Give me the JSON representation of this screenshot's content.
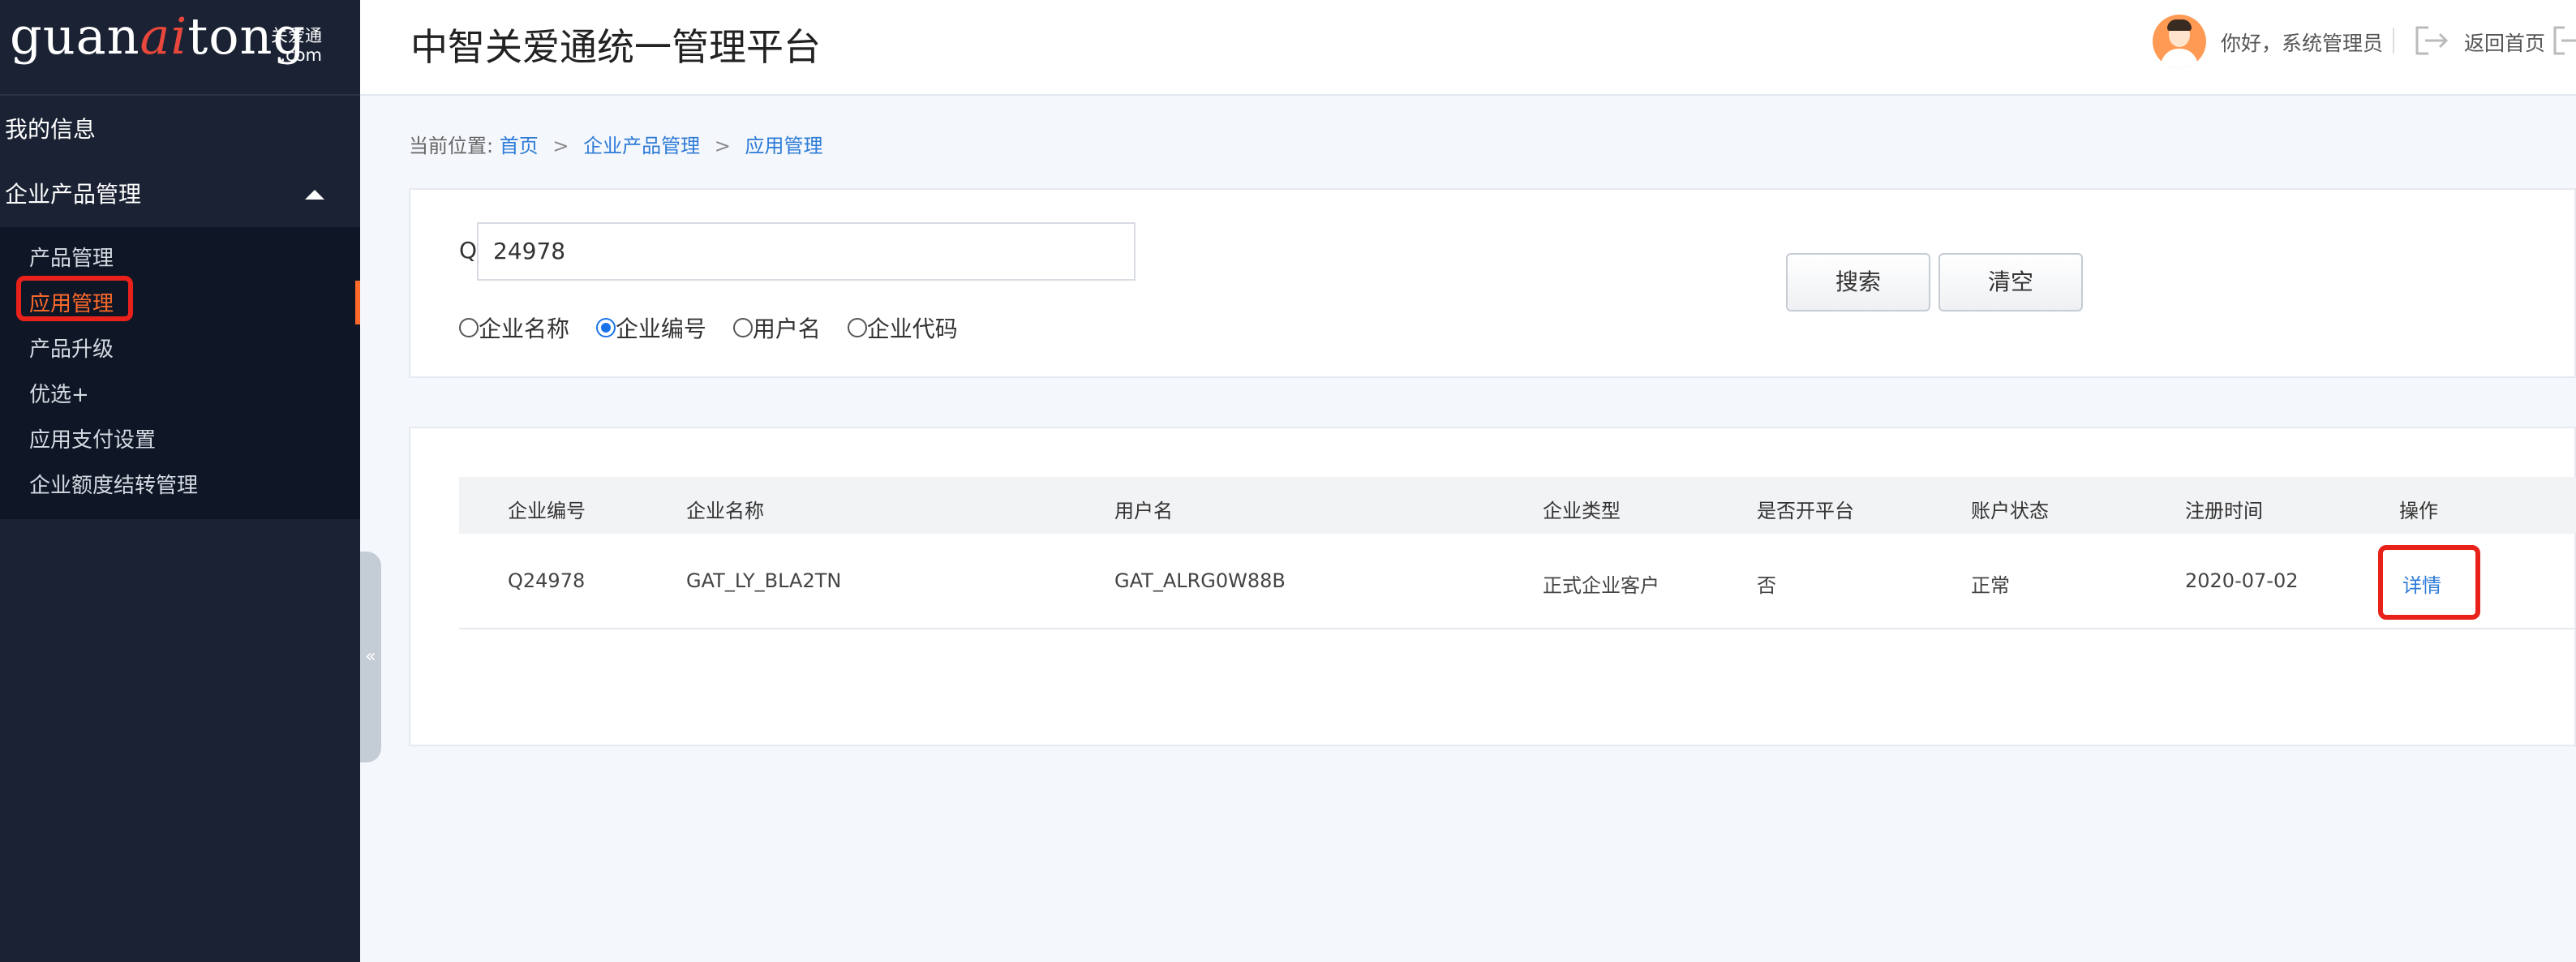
{
  "logo": {
    "prefix": "guan",
    "accent": "ai",
    "suffix": "tong",
    "sub_cn": "关爱通",
    "sub_com": ".com"
  },
  "header": {
    "title": "中智关爱通统一管理平台",
    "greeting": "你好，系统管理员",
    "back_home": "返回首页"
  },
  "sidebar": {
    "my_info": "我的信息",
    "section": "企业产品管理",
    "items": [
      "产品管理",
      "应用管理",
      "产品升级",
      "优选+",
      "应用支付设置",
      "企业额度结转管理"
    ],
    "active_index": 1
  },
  "breadcrumb": {
    "prefix": "当前位置:",
    "items": [
      "首页",
      "企业产品管理",
      "应用管理"
    ]
  },
  "search": {
    "label": "Q",
    "value": "24978",
    "options": [
      "企业名称",
      "企业编号",
      "用户名",
      "企业代码"
    ],
    "selected": "企业编号",
    "search_btn": "搜索",
    "clear_btn": "清空"
  },
  "table": {
    "columns": [
      "企业编号",
      "企业名称",
      "用户名",
      "企业类型",
      "是否开平台",
      "账户状态",
      "注册时间",
      "操作"
    ],
    "rows": [
      [
        "Q24978",
        "GAT_LY_BLA2TN",
        "GAT_ALRG0W88B",
        "正式企业客户",
        "否",
        "正常",
        "2020-07-02",
        "详情"
      ]
    ]
  },
  "colors": {
    "accent": "#ff6a2b",
    "link": "#2d7bd8",
    "highlight": "#e8211b",
    "sidebar": "#1a2233"
  },
  "collapse_glyph": "«"
}
